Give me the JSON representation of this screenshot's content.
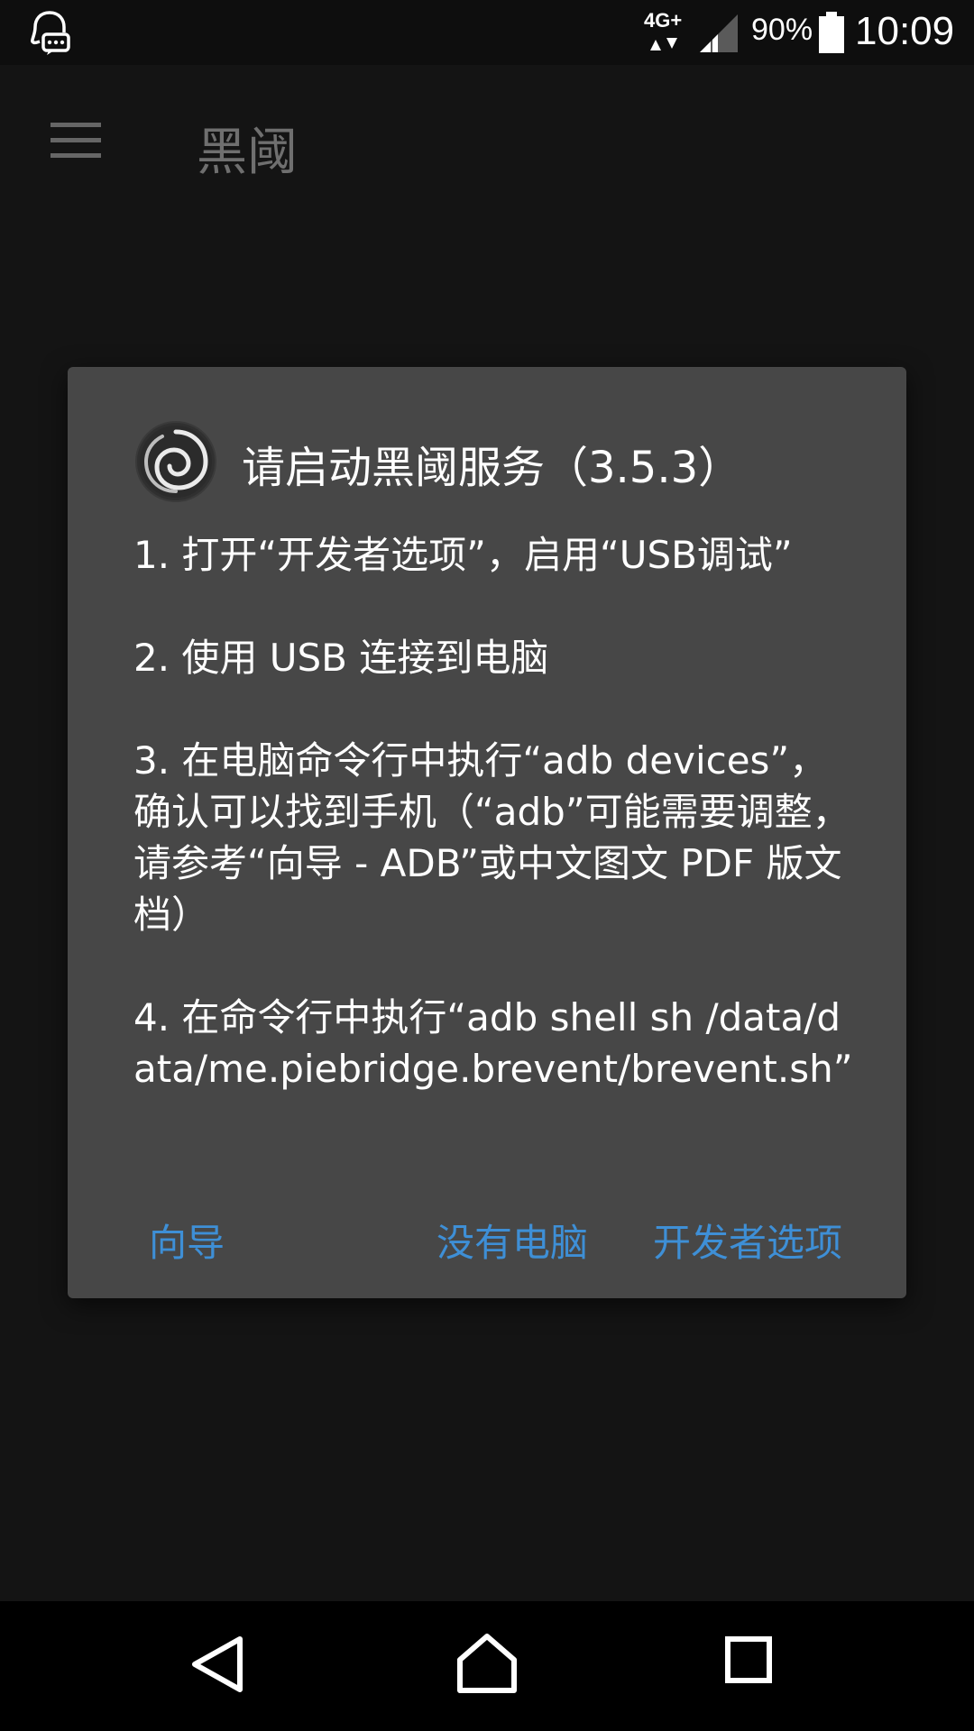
{
  "status_bar": {
    "network": "4G+",
    "battery": "90%",
    "time": "10:09",
    "icons": [
      "assistant-icon",
      "network-arrows-icon",
      "signal-icon",
      "battery-icon"
    ]
  },
  "app_bar": {
    "title": "黑阈",
    "menu_icon": "menu-icon"
  },
  "dialog": {
    "icon": "brevent-swirl-icon",
    "title": "请启动黑阈服务（3.5.3）",
    "steps": [
      "1. 打开“开发者选项”，启用“USB调试”",
      "2. 使用 USB 连接到电脑",
      "3. 在电脑命令行中执行“adb devices”，确认可以找到手机（“adb”可能需要调整，请参考“向导 - ADB”或中文图文 PDF 版文档）",
      "4. 在命令行中执行“adb shell sh /data/data/me.piebridge.brevent/brevent.sh”"
    ],
    "buttons": {
      "guide": "向导",
      "no_computer": "没有电脑",
      "developer_options": "开发者选项"
    },
    "accent_color": "#3e8fd6",
    "background_color": "#474747"
  },
  "nav_bar": {
    "icons": [
      "back-icon",
      "home-icon",
      "recent-apps-icon"
    ]
  }
}
